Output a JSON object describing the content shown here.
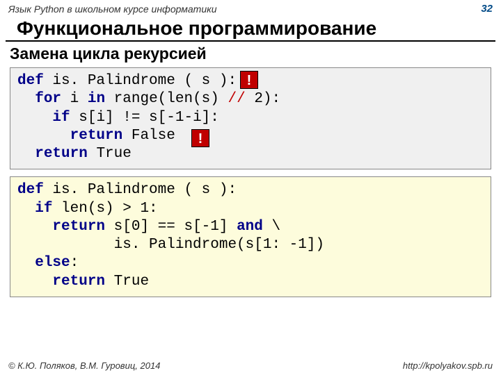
{
  "header": {
    "course_title": "Язык Python в школьном курсе информатики",
    "page_number": "32"
  },
  "title": "Функциональное программирование",
  "subtitle": "Замена цикла рекурсией",
  "code1": {
    "kw_def": "def",
    "fn": " is. Palindrome ( s ):",
    "kw_for": "for",
    "for_tail": " i ",
    "kw_in": "in",
    "range_call": " range(len(s) ",
    "op_floor": "//",
    "two": " 2):",
    "kw_if": "if",
    "if_cond": " s[i] != s[-1-i]:",
    "kw_return1": "return",
    "false": " False",
    "kw_return2": "return",
    "true": " True",
    "bang1": "!",
    "bang2": "!"
  },
  "code2": {
    "kw_def": "def",
    "fn": " is. Palindrome ( s ):",
    "kw_if": "if",
    "cond": " len(s) > 1:",
    "kw_return1": "return",
    "expr1": " s[0] == s[-1] ",
    "kw_and": "and",
    "cont": " \\",
    "expr2": "           is. Palindrome(s[1: -1])",
    "kw_else": "else",
    "colon": ":",
    "kw_return2": "return",
    "true": " True"
  },
  "footer": {
    "copyright_symbol": "©",
    "authors": " К.Ю. Поляков, В.М. Гуровиц, 2014",
    "url": "http://kpolyakov.spb.ru"
  }
}
